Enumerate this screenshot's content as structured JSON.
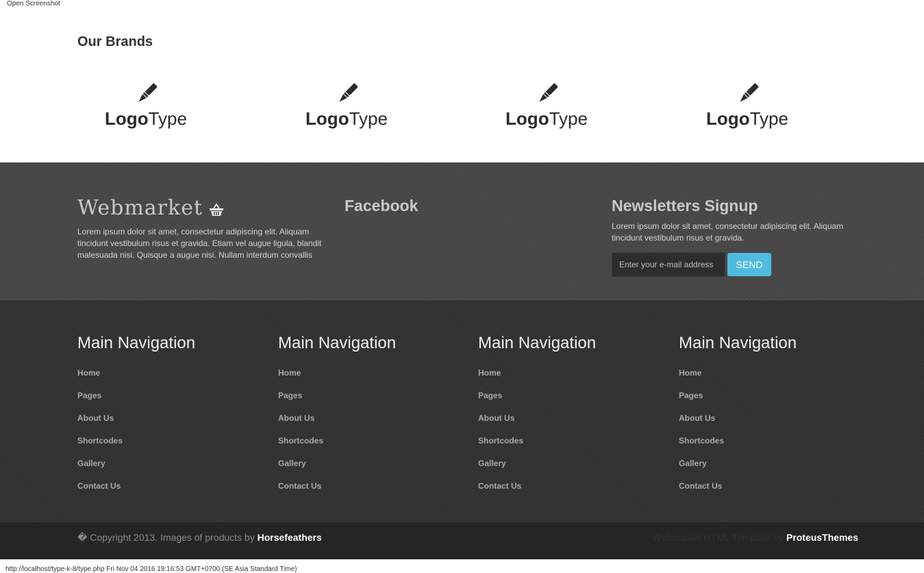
{
  "window": {
    "top_label": "Open Screenshot",
    "status_url": "http://localhost/type-k-8/type.php Fri Nov 04 2016 19:16:53 GMT+0700 (SE Asia Standard Time)"
  },
  "brands": {
    "title_light": "Our",
    "title_bold": "Brands",
    "logos": [
      {
        "bold": "Logo",
        "light": "Type",
        "icon": "pen-icon"
      },
      {
        "bold": "Logo",
        "light": "Type",
        "icon": "pen-icon"
      },
      {
        "bold": "Logo",
        "light": "Type",
        "icon": "pen-icon"
      },
      {
        "bold": "Logo",
        "light": "Type",
        "icon": "pen-icon"
      }
    ]
  },
  "about": {
    "title": "Webmarket",
    "icon": "basket-icon",
    "text": "Lorem ipsum dolor sit amet, consectetur adipiscing elit. Aliquam tincidunt vestibulum risus et gravida. Etiam vel augue ligula, blandit malesuada nisi. Quisque a augue nisi. Nullam interdum convallis"
  },
  "facebook": {
    "title": "Facebook"
  },
  "newsletter": {
    "title": "Newsletters Signup",
    "text": "Lorem ipsum dolor sit amet, consectetur adipiscing elit. Aliquam tincidunt vestibulum risus et gravida.",
    "placeholder": "Enter your e-mail address",
    "button": "SEND",
    "button_color": "#4fbbdf"
  },
  "navs": [
    {
      "title": "Main Navigation",
      "items": [
        "Home",
        "Pages",
        "About Us",
        "Shortcodes",
        "Gallery",
        "Contact Us"
      ]
    },
    {
      "title": "Main Navigation",
      "items": [
        "Home",
        "Pages",
        "About Us",
        "Shortcodes",
        "Gallery",
        "Contact Us"
      ]
    },
    {
      "title": "Main Navigation",
      "items": [
        "Home",
        "Pages",
        "About Us",
        "Shortcodes",
        "Gallery",
        "Contact Us"
      ]
    },
    {
      "title": "Main Navigation",
      "items": [
        "Home",
        "Pages",
        "About Us",
        "Shortcodes",
        "Gallery",
        "Contact Us"
      ]
    }
  ],
  "footer": {
    "copyright_prefix": "� Copyright 2013. Images of products by",
    "copyright_link": "Horsefeathers",
    "credit_prefix": "Webmarket HTML Template by",
    "credit_link": "ProteusThemes"
  }
}
